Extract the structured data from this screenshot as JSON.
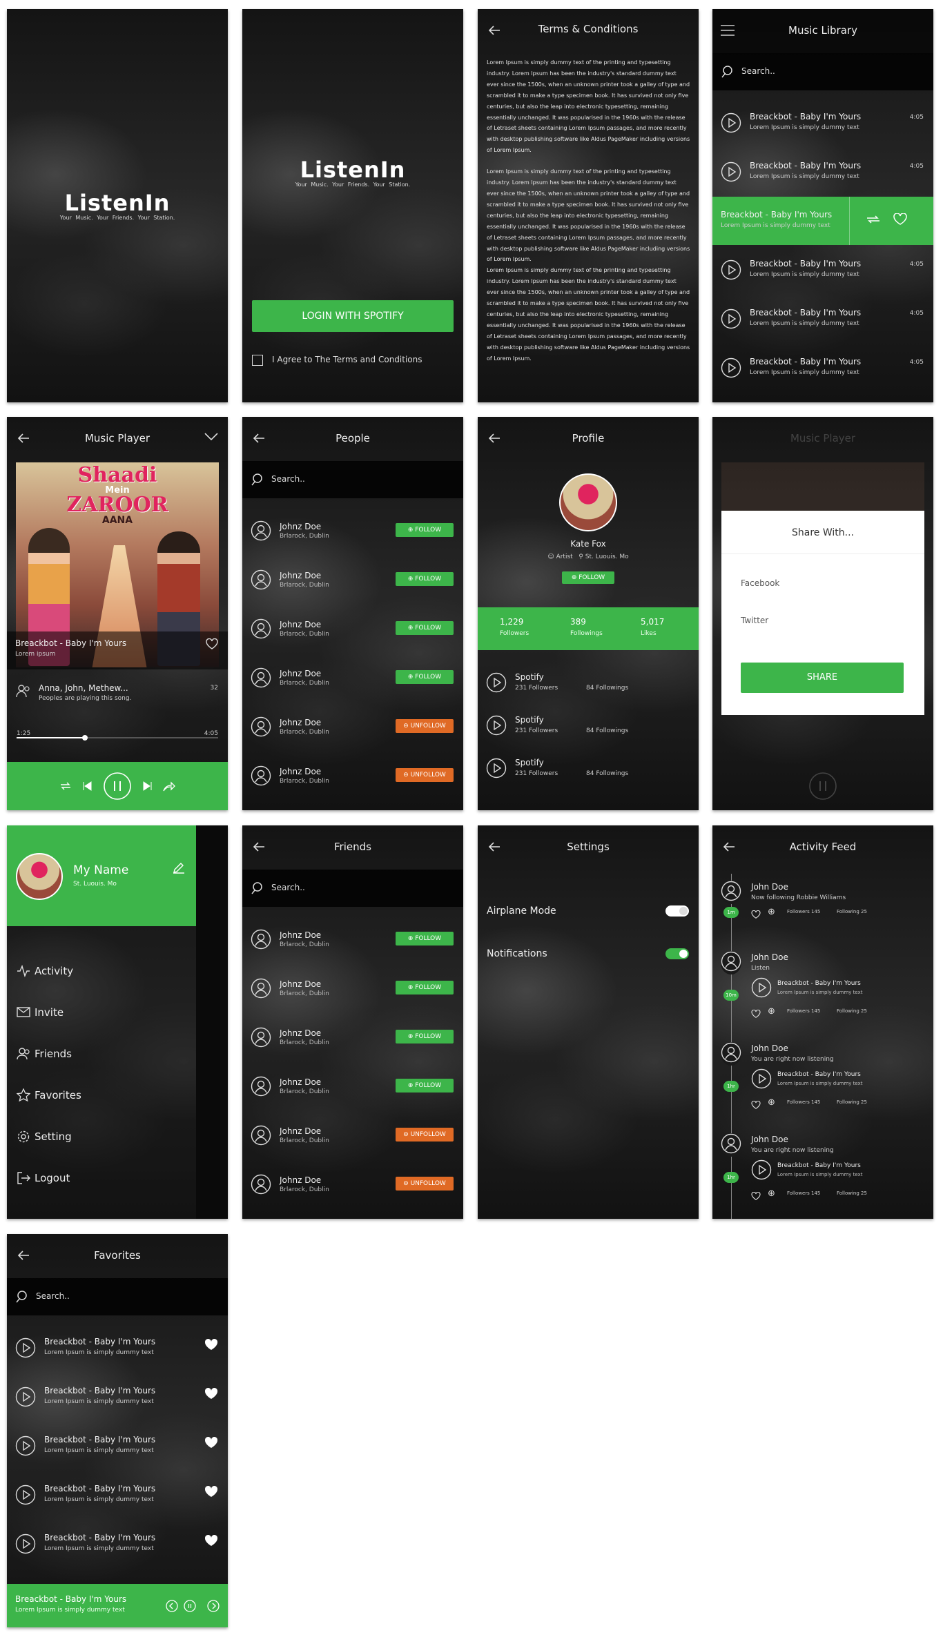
{
  "brand": {
    "name": "ListenIn",
    "tagline": "Your Music.   Your Friends.   Your Station."
  },
  "login": {
    "button": "LOGIN WITH SPOTIFY",
    "agree": "I Agree to The Terms and Conditions"
  },
  "terms": {
    "title": "Terms & Conditions",
    "p1": "Lorem Ipsum is simply dummy text of the printing and typesetting industry. Lorem Ipsum has been the industry's standard dummy text ever since the 1500s, when an unknown printer took a galley of type and scrambled it to make a type specimen book. It has survived not only five centuries, but also the leap into electronic typesetting, remaining essentially unchanged. It was popularised in the 1960s with the release of Letraset sheets containing Lorem Ipsum passages, and more recently with desktop publishing software like Aldus PageMaker including versions of Lorem Ipsum.",
    "p2": "Lorem Ipsum is simply dummy text of the printing and typesetting industry. Lorem Ipsum has been the industry's standard dummy text ever since the 1500s, when an unknown printer took a galley of type and scrambled it to make a type specimen book. It has survived not only five centuries, but also the leap into electronic typesetting, remaining essentially unchanged. It was popularised in the 1960s with the release of Letraset sheets containing Lorem Ipsum passages, and more recently with desktop publishing software like Aldus PageMaker including versions of Lorem Ipsum.",
    "p3": "Lorem Ipsum is simply dummy text of the printing and typesetting industry. Lorem Ipsum has been the industry's standard dummy text ever since the 1500s, when an unknown printer took a galley of type and scrambled it to make a type specimen book. It has survived not only five centuries, but also the leap into electronic typesetting, remaining essentially unchanged. It was popularised in the 1960s with the release of Letraset sheets containing Lorem Ipsum passages, and more recently with desktop publishing software like Aldus PageMaker including versions of Lorem Ipsum."
  },
  "library": {
    "title": "Music Library",
    "search": "Search..",
    "track_title": "Breackbot - Baby I'm Yours",
    "track_sub": "Lorem Ipsum is simply dummy text",
    "duration": "4:05"
  },
  "player": {
    "title": "Music Player",
    "poster": {
      "line1": "Shaadi",
      "line2": "Mein",
      "line3": "ZAROOR",
      "line4": "AANA"
    },
    "song": "Breackbot - Baby I'm Yours",
    "artist": "Lorem ipsum",
    "listeners": "Anna, John, Methew...",
    "listeners_sub": "Peoples are playing this song.",
    "listeners_count": "32",
    "time_current": "1:25",
    "time_total": "4:05",
    "progress": 0.34
  },
  "people": {
    "title": "People",
    "search": "Search..",
    "name": "Johnz Doe",
    "location": "Brlarock, Dublin",
    "follow": "FOLLOW",
    "unfollow": "UNFOLLOW"
  },
  "profile": {
    "title": "Profile",
    "name": "Kate Fox",
    "role": "Artist",
    "location": "St. Luouis. Mo",
    "follow": "FOLLOW",
    "stats": [
      {
        "value": "1,229",
        "label": "Followers"
      },
      {
        "value": "389",
        "label": "Followings"
      },
      {
        "value": "5,017",
        "label": "Likes"
      }
    ],
    "item_title": "Spotify",
    "item_followers": "231 Followers",
    "item_followings": "84 Followings"
  },
  "share": {
    "title": "Share With...",
    "facebook": "Facebook",
    "twitter": "Twitter",
    "button": "SHARE",
    "bg_title": "Music Player"
  },
  "drawer": {
    "name": "My Name",
    "location": "St. Luouis. Mo",
    "items": [
      "Activity",
      "Invite",
      "Friends",
      "Favorites",
      "Setting",
      "Logout"
    ]
  },
  "friends": {
    "title": "Friends"
  },
  "settings": {
    "title": "Settings",
    "airplane": "Airplane Mode",
    "notifications": "Notifications"
  },
  "activity": {
    "title": "Activity Feed",
    "user": "John Doe",
    "e1": "Now following Robbie Williams",
    "e2": "Listen",
    "e3": "You are right now listening",
    "followers": "Followers 145",
    "following": "Following 25",
    "t1": "1m",
    "t2": "10m",
    "t3": "1hr",
    "t4": "1hr"
  },
  "favorites": {
    "title": "Favorites"
  },
  "colors": {
    "accent": "#3db54a",
    "unfollow": "#e06a25",
    "background": "#1a1a1a"
  }
}
